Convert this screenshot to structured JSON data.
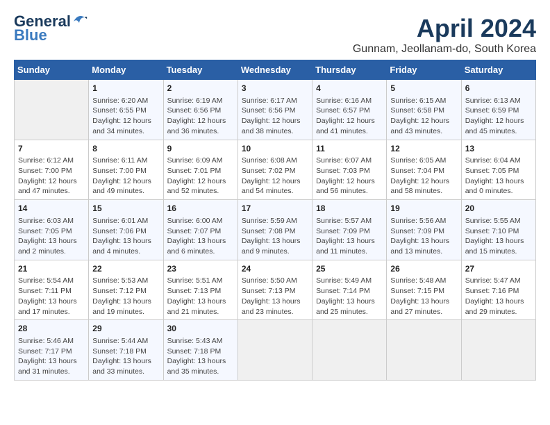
{
  "header": {
    "logo_line1": "General",
    "logo_line2": "Blue",
    "month_title": "April 2024",
    "location": "Gunnam, Jeollanam-do, South Korea"
  },
  "weekdays": [
    "Sunday",
    "Monday",
    "Tuesday",
    "Wednesday",
    "Thursday",
    "Friday",
    "Saturday"
  ],
  "weeks": [
    [
      {
        "day": "",
        "info": ""
      },
      {
        "day": "1",
        "info": "Sunrise: 6:20 AM\nSunset: 6:55 PM\nDaylight: 12 hours\nand 34 minutes."
      },
      {
        "day": "2",
        "info": "Sunrise: 6:19 AM\nSunset: 6:56 PM\nDaylight: 12 hours\nand 36 minutes."
      },
      {
        "day": "3",
        "info": "Sunrise: 6:17 AM\nSunset: 6:56 PM\nDaylight: 12 hours\nand 38 minutes."
      },
      {
        "day": "4",
        "info": "Sunrise: 6:16 AM\nSunset: 6:57 PM\nDaylight: 12 hours\nand 41 minutes."
      },
      {
        "day": "5",
        "info": "Sunrise: 6:15 AM\nSunset: 6:58 PM\nDaylight: 12 hours\nand 43 minutes."
      },
      {
        "day": "6",
        "info": "Sunrise: 6:13 AM\nSunset: 6:59 PM\nDaylight: 12 hours\nand 45 minutes."
      }
    ],
    [
      {
        "day": "7",
        "info": "Sunrise: 6:12 AM\nSunset: 7:00 PM\nDaylight: 12 hours\nand 47 minutes."
      },
      {
        "day": "8",
        "info": "Sunrise: 6:11 AM\nSunset: 7:00 PM\nDaylight: 12 hours\nand 49 minutes."
      },
      {
        "day": "9",
        "info": "Sunrise: 6:09 AM\nSunset: 7:01 PM\nDaylight: 12 hours\nand 52 minutes."
      },
      {
        "day": "10",
        "info": "Sunrise: 6:08 AM\nSunset: 7:02 PM\nDaylight: 12 hours\nand 54 minutes."
      },
      {
        "day": "11",
        "info": "Sunrise: 6:07 AM\nSunset: 7:03 PM\nDaylight: 12 hours\nand 56 minutes."
      },
      {
        "day": "12",
        "info": "Sunrise: 6:05 AM\nSunset: 7:04 PM\nDaylight: 12 hours\nand 58 minutes."
      },
      {
        "day": "13",
        "info": "Sunrise: 6:04 AM\nSunset: 7:05 PM\nDaylight: 13 hours\nand 0 minutes."
      }
    ],
    [
      {
        "day": "14",
        "info": "Sunrise: 6:03 AM\nSunset: 7:05 PM\nDaylight: 13 hours\nand 2 minutes."
      },
      {
        "day": "15",
        "info": "Sunrise: 6:01 AM\nSunset: 7:06 PM\nDaylight: 13 hours\nand 4 minutes."
      },
      {
        "day": "16",
        "info": "Sunrise: 6:00 AM\nSunset: 7:07 PM\nDaylight: 13 hours\nand 6 minutes."
      },
      {
        "day": "17",
        "info": "Sunrise: 5:59 AM\nSunset: 7:08 PM\nDaylight: 13 hours\nand 9 minutes."
      },
      {
        "day": "18",
        "info": "Sunrise: 5:57 AM\nSunset: 7:09 PM\nDaylight: 13 hours\nand 11 minutes."
      },
      {
        "day": "19",
        "info": "Sunrise: 5:56 AM\nSunset: 7:09 PM\nDaylight: 13 hours\nand 13 minutes."
      },
      {
        "day": "20",
        "info": "Sunrise: 5:55 AM\nSunset: 7:10 PM\nDaylight: 13 hours\nand 15 minutes."
      }
    ],
    [
      {
        "day": "21",
        "info": "Sunrise: 5:54 AM\nSunset: 7:11 PM\nDaylight: 13 hours\nand 17 minutes."
      },
      {
        "day": "22",
        "info": "Sunrise: 5:53 AM\nSunset: 7:12 PM\nDaylight: 13 hours\nand 19 minutes."
      },
      {
        "day": "23",
        "info": "Sunrise: 5:51 AM\nSunset: 7:13 PM\nDaylight: 13 hours\nand 21 minutes."
      },
      {
        "day": "24",
        "info": "Sunrise: 5:50 AM\nSunset: 7:13 PM\nDaylight: 13 hours\nand 23 minutes."
      },
      {
        "day": "25",
        "info": "Sunrise: 5:49 AM\nSunset: 7:14 PM\nDaylight: 13 hours\nand 25 minutes."
      },
      {
        "day": "26",
        "info": "Sunrise: 5:48 AM\nSunset: 7:15 PM\nDaylight: 13 hours\nand 27 minutes."
      },
      {
        "day": "27",
        "info": "Sunrise: 5:47 AM\nSunset: 7:16 PM\nDaylight: 13 hours\nand 29 minutes."
      }
    ],
    [
      {
        "day": "28",
        "info": "Sunrise: 5:46 AM\nSunset: 7:17 PM\nDaylight: 13 hours\nand 31 minutes."
      },
      {
        "day": "29",
        "info": "Sunrise: 5:44 AM\nSunset: 7:18 PM\nDaylight: 13 hours\nand 33 minutes."
      },
      {
        "day": "30",
        "info": "Sunrise: 5:43 AM\nSunset: 7:18 PM\nDaylight: 13 hours\nand 35 minutes."
      },
      {
        "day": "",
        "info": ""
      },
      {
        "day": "",
        "info": ""
      },
      {
        "day": "",
        "info": ""
      },
      {
        "day": "",
        "info": ""
      }
    ]
  ]
}
